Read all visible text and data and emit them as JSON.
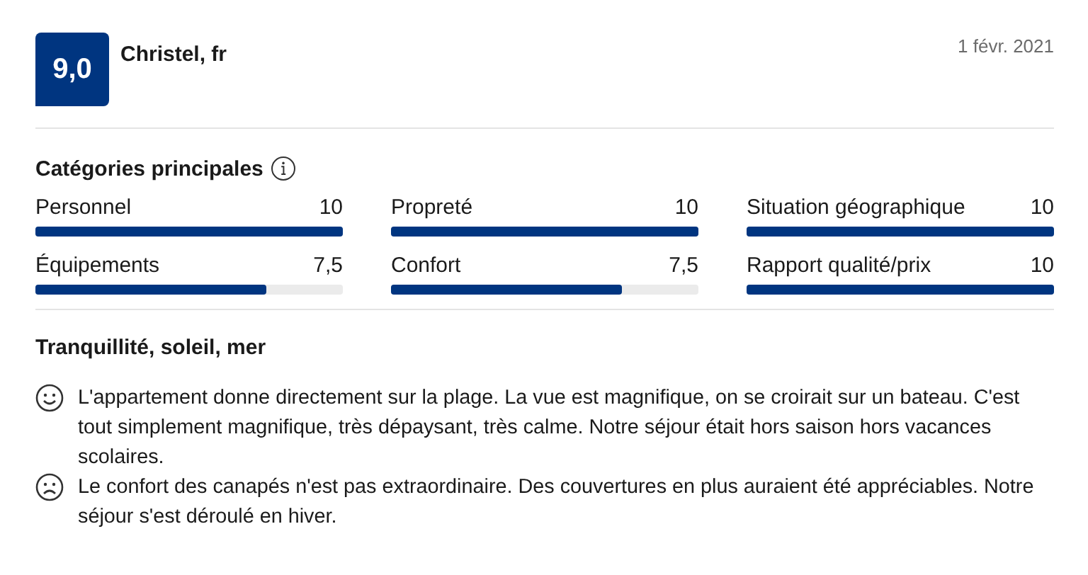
{
  "review": {
    "score": "9,0",
    "reviewer": "Christel, fr",
    "date": "1 févr. 2021"
  },
  "categories": {
    "title": "Catégories principales",
    "items": [
      {
        "label": "Personnel",
        "value": "10",
        "level": 1
      },
      {
        "label": "Propreté",
        "value": "10",
        "level": 1
      },
      {
        "label": "Situation géographique",
        "value": "10",
        "level": 1
      },
      {
        "label": "Équipements",
        "value": "7,5",
        "level": 0.75
      },
      {
        "label": "Confort",
        "value": "7,5",
        "level": 0.75
      },
      {
        "label": "Rapport qualité/prix",
        "value": "10",
        "level": 1
      }
    ]
  },
  "comment": {
    "title": "Tranquillité, soleil, mer",
    "items": [
      {
        "kind": "positive",
        "text": "L'appartement donne directement sur la plage. La vue est magnifique, on se croirait sur un bateau. C'est tout simplement magnifique, très dépaysant, très calme. Notre séjour était hors saison hors vacances scolaires."
      },
      {
        "kind": "negative",
        "text": "Le confort des canapés n'est pas extraordinaire. Des couvertures en plus auraient été appréciables. Notre séjour s'est déroulé en hiver."
      }
    ]
  }
}
